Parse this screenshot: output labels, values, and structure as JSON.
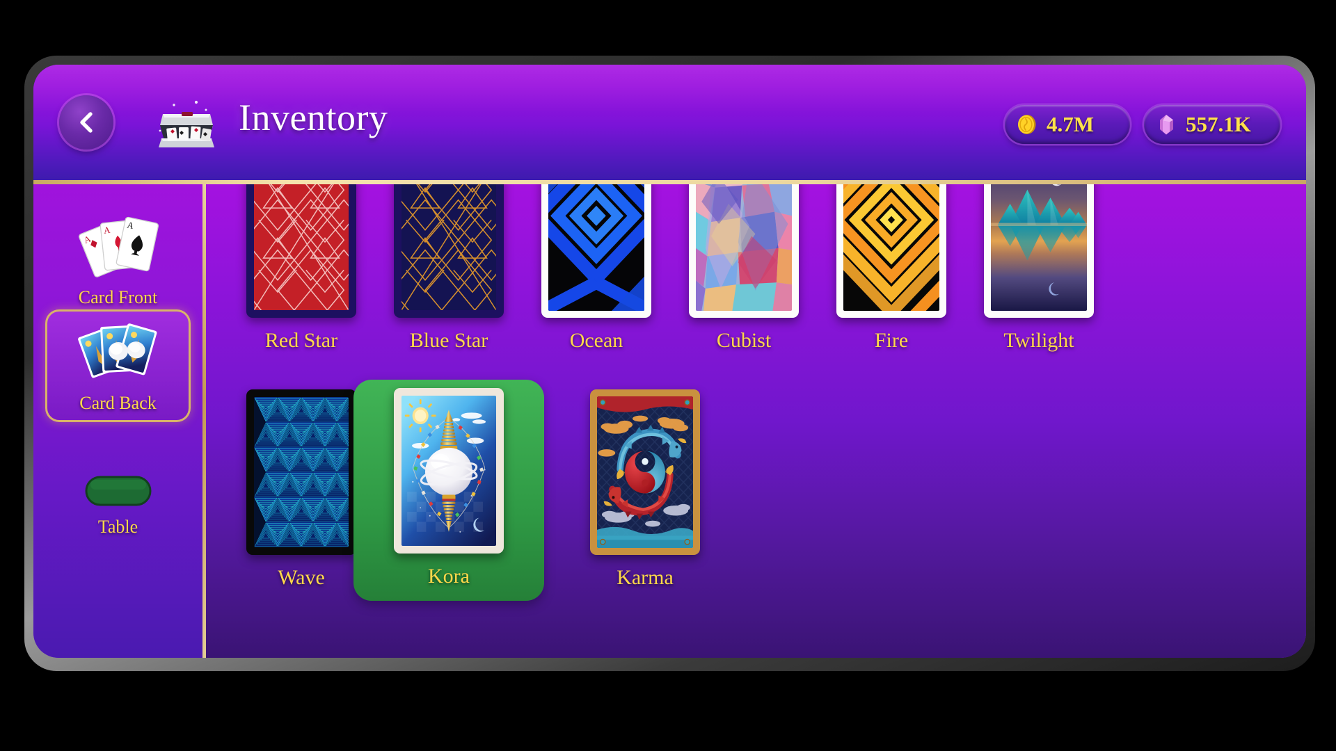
{
  "header": {
    "title": "Inventory",
    "back_icon": "chevron-left-icon",
    "title_icon": "card-shuffler-icon",
    "currencies": [
      {
        "id": "coins",
        "icon": "gold-coin-icon",
        "amount": "4.7M",
        "color": "#ffd74a"
      },
      {
        "id": "gems",
        "icon": "pink-gem-icon",
        "amount": "557.1K",
        "color": "#e8a6ef"
      }
    ]
  },
  "sidebar": {
    "items": [
      {
        "id": "card-front",
        "label": "Card Front",
        "icon": "aces-fan-icon",
        "selected": false
      },
      {
        "id": "card-back",
        "label": "Card Back",
        "icon": "card-back-fan-icon",
        "selected": true
      },
      {
        "id": "table",
        "label": "Table",
        "icon": "green-table-icon",
        "selected": false
      }
    ]
  },
  "grid": {
    "rows": [
      [
        {
          "id": "red-star",
          "label": "Red Star",
          "frame": "navy",
          "selected": false
        },
        {
          "id": "blue-star",
          "label": "Blue Star",
          "frame": "navy",
          "selected": false
        },
        {
          "id": "ocean",
          "label": "Ocean",
          "frame": "white",
          "selected": false
        },
        {
          "id": "cubist",
          "label": "Cubist",
          "frame": "white",
          "selected": false
        },
        {
          "id": "fire",
          "label": "Fire",
          "frame": "white",
          "selected": false
        },
        {
          "id": "twilight",
          "label": "Twilight",
          "frame": "white",
          "selected": false
        }
      ],
      [
        {
          "id": "wave",
          "label": "Wave",
          "frame": "black",
          "selected": false
        },
        {
          "id": "kora",
          "label": "Kora",
          "frame": "cream",
          "selected": true
        },
        {
          "id": "karma",
          "label": "Karma",
          "frame": "gold",
          "selected": false
        }
      ]
    ]
  },
  "theme": {
    "accent_gold": "#ffd84a",
    "rail_gold": "#e3cd93",
    "header_purple": "#8e14da",
    "selected_green": "#2f9a45"
  }
}
